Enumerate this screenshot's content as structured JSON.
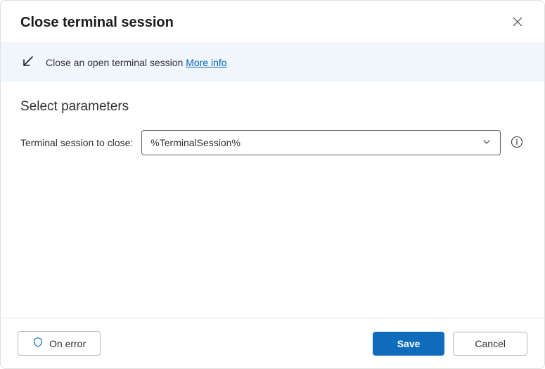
{
  "header": {
    "title": "Close terminal session"
  },
  "banner": {
    "description": "Close an open terminal session",
    "link_text": "More info"
  },
  "content": {
    "section_title": "Select parameters",
    "param_label": "Terminal session to close:",
    "dropdown_value": "%TerminalSession%"
  },
  "footer": {
    "on_error_label": "On error",
    "save_label": "Save",
    "cancel_label": "Cancel"
  }
}
